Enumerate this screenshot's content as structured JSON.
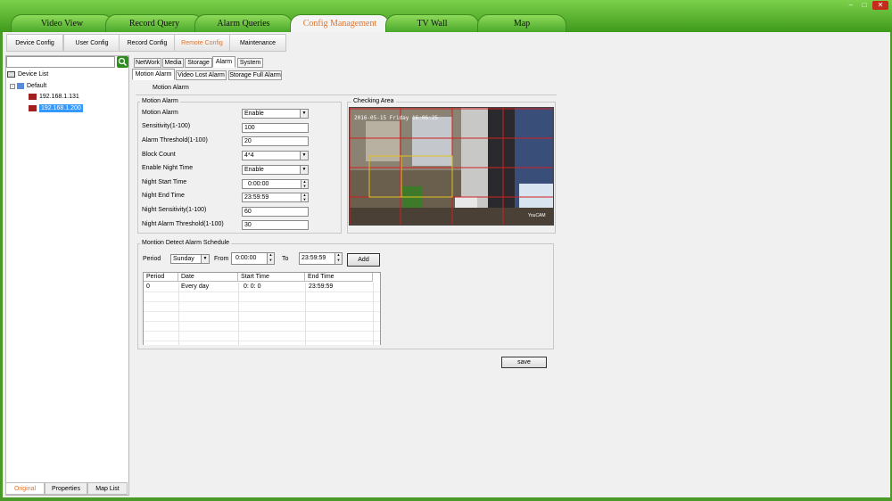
{
  "main_tabs": [
    {
      "label": "Video View"
    },
    {
      "label": "Record Query"
    },
    {
      "label": "Alarm Queries"
    },
    {
      "label": "Config Management",
      "active": true
    },
    {
      "label": "TV Wall"
    },
    {
      "label": "Map"
    }
  ],
  "window_controls": {
    "minimize": "–",
    "maximize": "□",
    "close": "✕"
  },
  "sub_tabs": [
    {
      "label": "Device Config"
    },
    {
      "label": "User Config"
    },
    {
      "label": "Record Config"
    },
    {
      "label": "Remote Config",
      "active": true
    },
    {
      "label": "Maintenance"
    }
  ],
  "device_tree": {
    "root": "Device List",
    "group": "Default",
    "devices": [
      "192.168.1.131",
      "192.168.1.200"
    ],
    "selected_index": 1
  },
  "bottom_tabs": [
    {
      "label": "Original",
      "active": true
    },
    {
      "label": "Properties"
    },
    {
      "label": "Map List"
    }
  ],
  "config_tabs": [
    "NetWork",
    "Media",
    "Storage",
    "Alarm",
    "System"
  ],
  "alarm_tabs": [
    "Motion Alarm",
    "Video Lost Alarm",
    "Storage Full Alarm"
  ],
  "panel_header": "Motion Alarm",
  "motion_group": {
    "title": "Motion Alarm",
    "fields": [
      {
        "label": "Motion Alarm",
        "value": "Enable",
        "kind": "combo"
      },
      {
        "label": "Sensitivity(1-100)",
        "value": "100",
        "kind": "text"
      },
      {
        "label": "Alarm Threshold(1-100)",
        "value": "20",
        "kind": "text"
      },
      {
        "label": "Block Count",
        "value": "4*4",
        "kind": "combo"
      },
      {
        "label": "Enable Night Time",
        "value": "Enable",
        "kind": "combo"
      },
      {
        "label": "Night Start Time",
        "value": "0:00:00",
        "kind": "spin"
      },
      {
        "label": "Night End Time",
        "value": "23:59:59",
        "kind": "spin"
      },
      {
        "label": "Night Sensitivity(1-100)",
        "value": "60",
        "kind": "text"
      },
      {
        "label": "Night Alarm Threshold(1-100)",
        "value": "30",
        "kind": "text"
      }
    ]
  },
  "checking_area": {
    "title": "Checking Area",
    "timestamp": "2016-05-15 Friday 16:06:25",
    "watermark": "YouCAM"
  },
  "schedule": {
    "title": "Montion Detect Alarm Schedule",
    "period_label": "Period",
    "period_value": "Sunday",
    "from_label": "From",
    "from_value": "0:00:00",
    "to_label": "To",
    "to_value": "23:59:59",
    "add_label": "Add",
    "columns": [
      "Period",
      "Date",
      "Start Time",
      "End Time"
    ],
    "rows": [
      [
        "0",
        "Every day",
        "0: 0: 0",
        "23:59:59"
      ]
    ]
  },
  "save_label": "save",
  "colors": {
    "accent": "#e0742a",
    "brand_green": "#4a9a2a",
    "selected": "#3399ff"
  }
}
